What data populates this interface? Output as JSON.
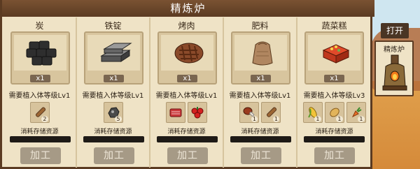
{
  "window": {
    "title": "精炼炉"
  },
  "side": {
    "open_label": "打开",
    "building_label": "精炼炉",
    "building_icon": "furnace-icon"
  },
  "cards": [
    {
      "name": "炭",
      "icon": "charcoal-icon",
      "quantity": "x1",
      "requirement": "需要植入体等级Lv1",
      "materials": [
        {
          "icon": "wood-log-icon",
          "count": "2"
        }
      ],
      "consume_label": "消耗存储资源",
      "button_label": "加工"
    },
    {
      "name": "铁锭",
      "icon": "iron-ingot-icon",
      "quantity": "x1",
      "requirement": "需要植入体等级Lv1",
      "materials": [
        {
          "icon": "iron-ore-icon",
          "count": "5"
        }
      ],
      "consume_label": "消耗存储资源",
      "button_label": "加工"
    },
    {
      "name": "烤肉",
      "icon": "roast-meat-icon",
      "quantity": "x1",
      "requirement": "需要植入体等级Lv1",
      "materials": [
        {
          "icon": "raw-meat-icon",
          "count": ""
        },
        {
          "icon": "berries-icon",
          "count": ""
        }
      ],
      "consume_label": "消耗存储资源",
      "button_label": "加工"
    },
    {
      "name": "肥料",
      "icon": "fertilizer-sack-icon",
      "quantity": "x1",
      "requirement": "需要植入体等级Lv1",
      "materials": [
        {
          "icon": "meat-drumstick-icon",
          "count": "1"
        },
        {
          "icon": "wood-log-icon",
          "count": "1"
        }
      ],
      "consume_label": "消耗存储资源",
      "button_label": "加工"
    },
    {
      "name": "蔬菜糕",
      "icon": "vegetable-cake-icon",
      "quantity": "x1",
      "requirement": "需要植入体等级Lv3",
      "materials": [
        {
          "icon": "corn-icon",
          "count": "1"
        },
        {
          "icon": "potato-icon",
          "count": "1"
        },
        {
          "icon": "carrot-icon",
          "count": "1"
        }
      ],
      "consume_label": "消耗存储资源",
      "button_label": "加工"
    }
  ]
}
